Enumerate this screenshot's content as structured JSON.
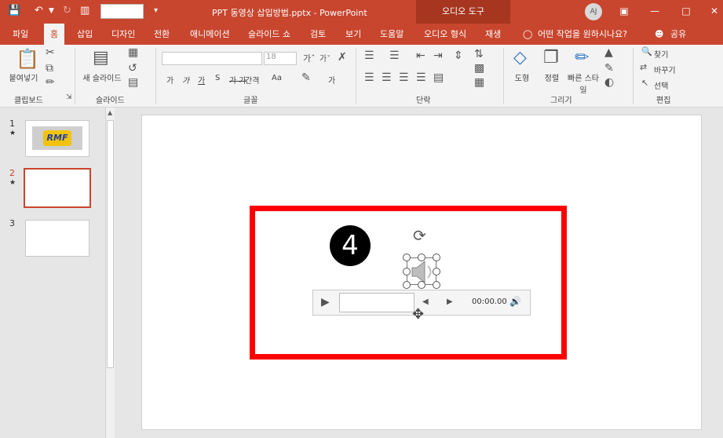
{
  "window": {
    "title": "PPT 동영상 삽입방법.pptx  -  PowerPoint",
    "context_tab": "오디오 도구",
    "user_initials": "AJ"
  },
  "tabs": [
    "파일",
    "홈",
    "삽입",
    "디자인",
    "전환",
    "애니메이션",
    "슬라이드 쇼",
    "검토",
    "보기",
    "도움말",
    "오디오 형식",
    "재생"
  ],
  "tell_me": "어떤 작업을 원하시나요?",
  "share": "공유",
  "ribbon": {
    "clipboard": {
      "paste": "붙여넣기",
      "label": "클립보드"
    },
    "slides": {
      "new_slide": "새 슬라이드",
      "label": "슬라이드"
    },
    "font": {
      "size": "18",
      "label": "글꼴",
      "btns": [
        "가",
        "가",
        "가",
        "S",
        "가 가",
        "간격",
        "Aa",
        "가"
      ]
    },
    "paragraph": {
      "label": "단락"
    },
    "drawing": {
      "shape": "도형",
      "arrange": "정렬",
      "quick_style": "빠른 스타일",
      "label": "그리기"
    },
    "editing": {
      "find": "찾기",
      "replace": "바꾸기",
      "select": "선택",
      "label": "편집"
    }
  },
  "slides": [
    {
      "num": "1",
      "star": "★",
      "logo": "RMF"
    },
    {
      "num": "2",
      "star": "★"
    },
    {
      "num": "3"
    }
  ],
  "annotation": {
    "badge": "4"
  },
  "player": {
    "time": "00:00.00"
  },
  "colors": {
    "accent": "#c8452e",
    "highlight": "#ff0000"
  }
}
